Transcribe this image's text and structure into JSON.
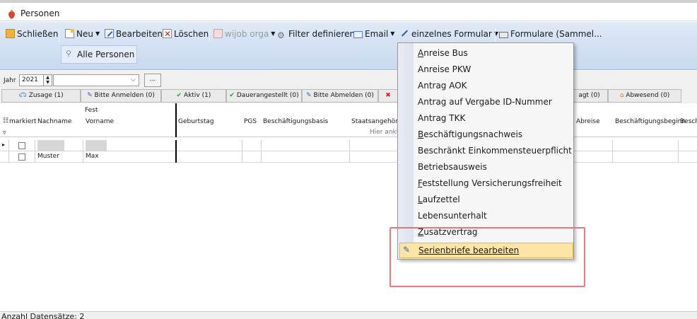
{
  "window": {
    "title": "Personen"
  },
  "toolbar": {
    "close_label": "Schließen",
    "new_label": "Neu",
    "edit_label": "Bearbeiten",
    "delete_label": "Löschen",
    "wijob_label": "wijob orga",
    "filter_label": "Filter definieren",
    "email_label": "Email",
    "single_form_label": "einzelnes Formular",
    "forms_label": "Formulare (Sammel...",
    "all_persons_label": "Alle Personen"
  },
  "filter": {
    "year_label": "Jahr",
    "year_value": "2021",
    "ellipsis_label": "..."
  },
  "tabs": [
    "Zusage (1)",
    "Bitte Anmelden (0)",
    "Aktiv (1)",
    "Dauerangestellt (0)",
    "Bitte Abmelden (0)",
    "agt (0)",
    "Abwesend (0)"
  ],
  "grid": {
    "group_header": "Fest",
    "columns": [
      "markiert",
      "Nachname",
      "Vorname",
      "Geburtstag",
      "PGS",
      "Beschäftigungsbasis",
      "Staatsangehörig",
      "Abreise",
      "Beschäftigungsbeginn",
      "Besch"
    ],
    "filter_hint": "Hier ankli",
    "rows": [
      {
        "nachname": "",
        "vorname": ""
      },
      {
        "nachname": "Muster",
        "vorname": "Max"
      }
    ]
  },
  "menu": {
    "items": [
      "Anreise Bus",
      "Anreise PKW",
      "Antrag AOK",
      "Antrag auf Vergabe ID-Nummer",
      "Antrag TKK",
      "Beschäftigungsnachweis",
      "Beschränkt Einkommensteuerpflicht",
      "Betriebsausweis",
      "Feststellung Versicherungsfreiheit",
      "Laufzettel",
      "Lebensunterhalt",
      "Zusatzvertrag"
    ],
    "selected_item": "Serienbriefe bearbeiten"
  },
  "status": {
    "record_count": "Anzahl Datensätze: 2"
  },
  "colors": {
    "highlight_box": "#e8787a",
    "menu_selection": "#fde6a5",
    "ribbon": "#dfe9f7"
  }
}
